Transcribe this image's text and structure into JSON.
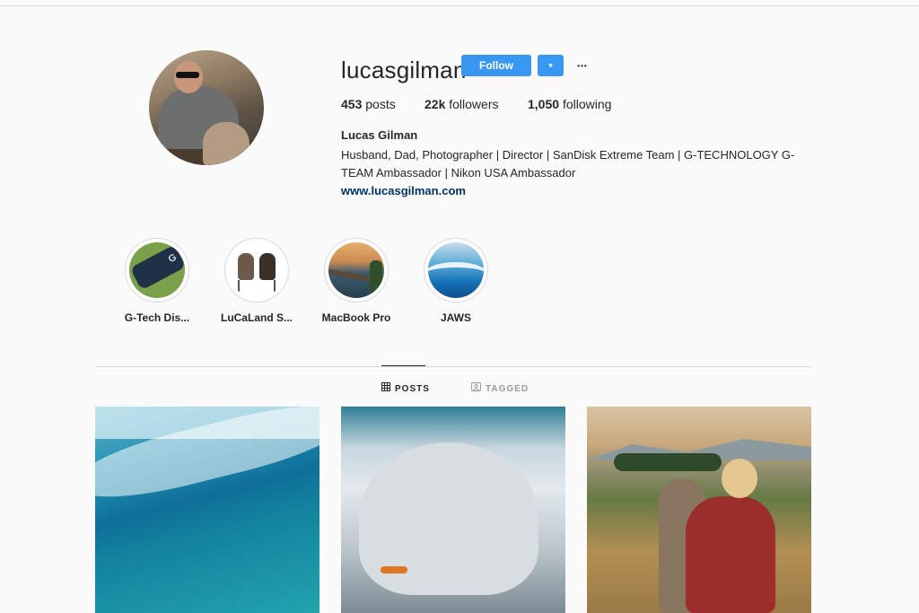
{
  "profile": {
    "username": "lucasgilman",
    "follow_label": "Follow",
    "dropdown_icon": "▾",
    "more_icon": "•••",
    "stats": {
      "posts_count": "453",
      "posts_label": "posts",
      "followers_count": "22k",
      "followers_label": "followers",
      "following_count": "1,050",
      "following_label": "following"
    },
    "full_name": "Lucas Gilman",
    "bio": "Husband, Dad, Photographer | Director | SanDisk Extreme Team | G-TECHNOLOGY G-TEAM Ambassador | Nikon USA Ambassador",
    "website": "www.lucasgilman.com"
  },
  "highlights": [
    {
      "label": "G-Tech Dis..."
    },
    {
      "label": "LuCaLand S..."
    },
    {
      "label": "MacBook Pro"
    },
    {
      "label": "JAWS"
    }
  ],
  "tabs": {
    "posts_label": "POSTS",
    "tagged_label": "TAGGED"
  },
  "colors": {
    "accent": "#3897f0",
    "link": "#003569"
  }
}
